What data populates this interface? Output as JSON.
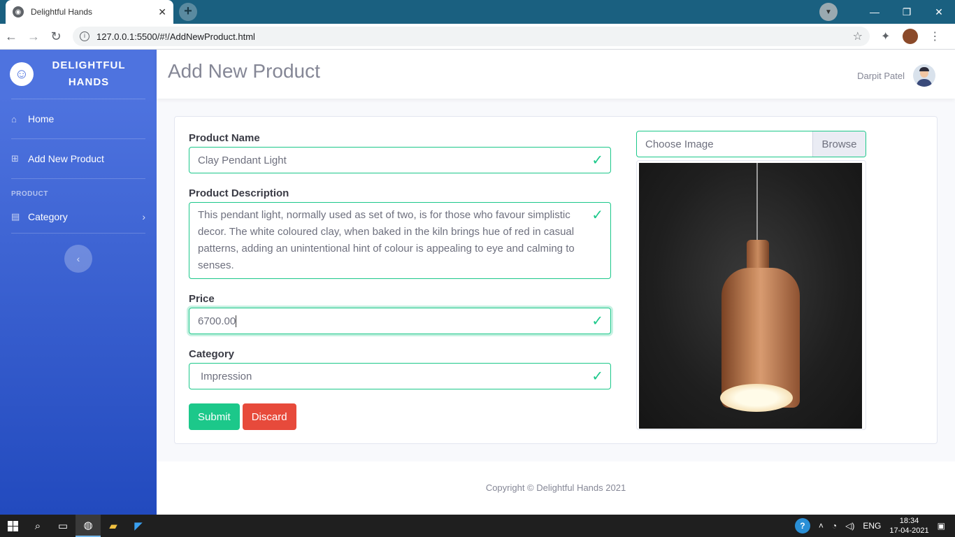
{
  "browser": {
    "tab_title": "Delightful Hands",
    "url": "127.0.0.1:5500/#!/AddNewProduct.html"
  },
  "sidebar": {
    "brand_line1": "DELIGHTFUL",
    "brand_line2": "HANDS",
    "items": [
      {
        "label": "Home",
        "icon": "home-icon"
      },
      {
        "label": "Add New Product",
        "icon": "plus-square-icon"
      }
    ],
    "heading": "PRODUCT",
    "category_label": "Category"
  },
  "topbar": {
    "title": "Add New Product",
    "user_name": "Darpit Patel"
  },
  "form": {
    "name_label": "Product Name",
    "name_value": "Clay Pendant Light",
    "description_label": "Product Description",
    "description_value": "This pendant light, normally used as set of two, is for those who favour simplistic decor. The white coloured clay, when baked  in the kiln brings hue of red in casual patterns, adding an unintentional hint of colour is appealing to eye and calming to senses.",
    "price_label": "Price",
    "price_value": "6700.00",
    "category_label": "Category",
    "category_value": "Impression",
    "submit_label": "Submit",
    "discard_label": "Discard"
  },
  "uploader": {
    "placeholder": "Choose Image",
    "browse_label": "Browse"
  },
  "footer": {
    "copyright": "Copyright © Delightful Hands 2021"
  },
  "taskbar": {
    "lang": "ENG",
    "time": "18:34",
    "date": "17-04-2021"
  },
  "colors": {
    "primary": "#4e73df",
    "success": "#1cc88a",
    "danger": "#e74a3b"
  }
}
